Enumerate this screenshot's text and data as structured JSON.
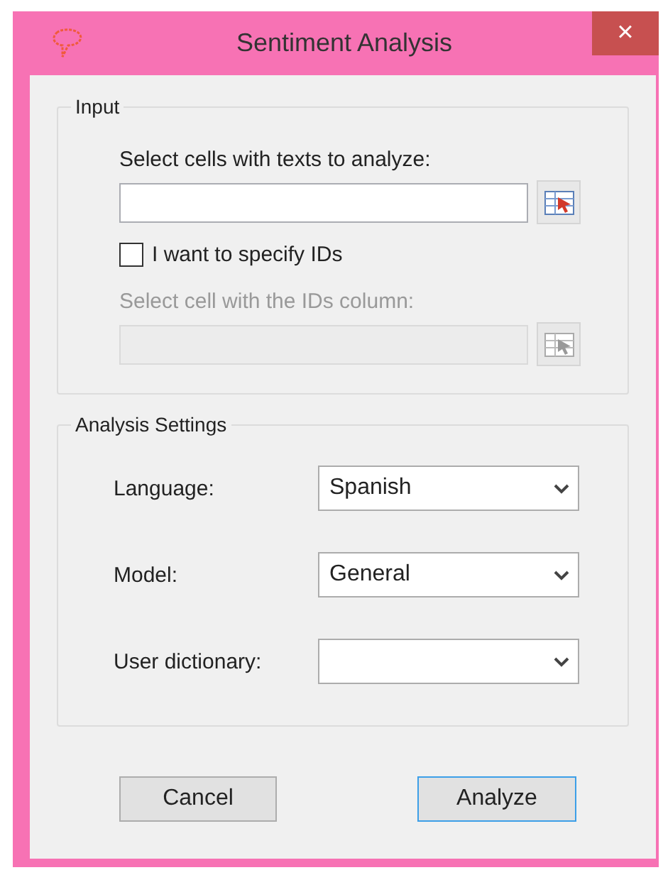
{
  "window": {
    "title": "Sentiment Analysis",
    "close": "×"
  },
  "input": {
    "legend": "Input",
    "fields": [
      {
        "label": "Select cells with texts to analyze:",
        "disabled": false
      },
      {
        "label": "Select cell with the IDs column:",
        "disabled": true
      }
    ],
    "checkbox": {
      "label": "I want to specify IDs",
      "checked": false
    }
  },
  "settings": {
    "legend": "Analysis Settings",
    "rows": [
      {
        "label": "Language:",
        "value": "Spanish"
      },
      {
        "label": "Model:",
        "value": "General"
      },
      {
        "label": "User dictionary:"
      }
    ]
  },
  "buttons": [
    {
      "label": "Cancel",
      "default": false
    },
    {
      "label": "Analyze",
      "default": true
    }
  ]
}
